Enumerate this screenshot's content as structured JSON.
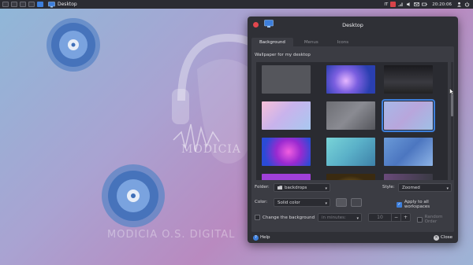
{
  "panel": {
    "app_title": "Desktop",
    "clock": "20:20:06",
    "lang": "IT",
    "workspaces": 5
  },
  "wallpaper": {
    "brand_a": "MODICIA",
    "brand_b": "MODICIA O.S. DIGITAL"
  },
  "dialog": {
    "title": "Desktop",
    "tabs": [
      {
        "label": "Background",
        "active": true
      },
      {
        "label": "Menus",
        "active": false
      },
      {
        "label": "Icons",
        "active": false
      }
    ],
    "caption": "Wallpaper for my desktop",
    "folder_label": "Folder:",
    "folder_value": "backdrops",
    "style_label": "Style:",
    "style_value": "Zoomed",
    "color_label": "Color:",
    "color_value": "Solid color",
    "apply_all_label": "Apply to all workspaces",
    "apply_all_checked": true,
    "change_bg_label": "Change the background",
    "change_bg_checked": false,
    "interval_unit": "in minutes:",
    "interval_value": "10",
    "random_label": "Random Order",
    "random_checked": false,
    "help_label": "Help",
    "close_label": "Close",
    "accent": "#3d7fdc"
  },
  "thumbnails": [
    {
      "name": "gray-plain"
    },
    {
      "name": "blue-purple-bokeh"
    },
    {
      "name": "dark-stage"
    },
    {
      "name": "pastel-music"
    },
    {
      "name": "gray-headphones"
    },
    {
      "name": "lavender-headphones",
      "selected": true
    },
    {
      "name": "magenta-vinyl"
    },
    {
      "name": "teal-headphones"
    },
    {
      "name": "blue-headphones"
    },
    {
      "name": "purple-partial"
    },
    {
      "name": "gold-partial"
    },
    {
      "name": "dark-partial"
    }
  ]
}
